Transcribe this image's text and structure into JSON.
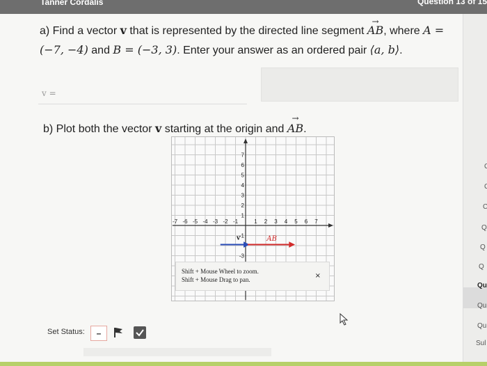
{
  "header": {
    "student_name": "Tanner Cordalis",
    "question_counter": "Question 13 of 15"
  },
  "part_a": {
    "prefix": "a) Find a vector ",
    "vec_v": "v",
    "mid1": " that is represented by the directed line segment ",
    "seg_AB": "AB",
    "mid2": ", where ",
    "A_eq": "A =",
    "A_val": "(−7, −4)",
    "mid3": " and ",
    "B_eq": "B = (−3, 3)",
    "mid4": ". Enter your answer as an ordered pair ",
    "pair": "⟨a, b⟩",
    "end": "."
  },
  "answer": {
    "label": "v ="
  },
  "part_b": {
    "prefix": "b) Plot both the vector ",
    "vec_v": "v",
    "mid": " starting at the origin and ",
    "seg_AB": "AB",
    "end": "."
  },
  "graph": {
    "x_ticks": [
      "-7",
      "-6",
      "-5",
      "-4",
      "-3",
      "-2",
      "-1",
      "1",
      "2",
      "3",
      "4",
      "5",
      "6",
      "7"
    ],
    "y_ticks": [
      "7",
      "6",
      "5",
      "4",
      "3",
      "2",
      "1",
      "-1",
      "-3",
      "-4"
    ],
    "label_v": "v",
    "label_AB": "AB",
    "colors": {
      "v": "#2a4db8",
      "AB": "#d22b2b",
      "grid": "#c8c8c8",
      "axis": "#333333"
    }
  },
  "tooltip": {
    "line1": "Shift + Mouse Wheel to zoom.",
    "line2": "Shift + Mouse Drag to pan.",
    "close": "×"
  },
  "status": {
    "label": "Set Status:",
    "dash": "–"
  },
  "sidebar": {
    "items": [
      "C",
      "C",
      "C",
      "Q",
      "Q",
      "Q",
      "Qu",
      "Qu",
      "Qu",
      "Sul"
    ]
  }
}
